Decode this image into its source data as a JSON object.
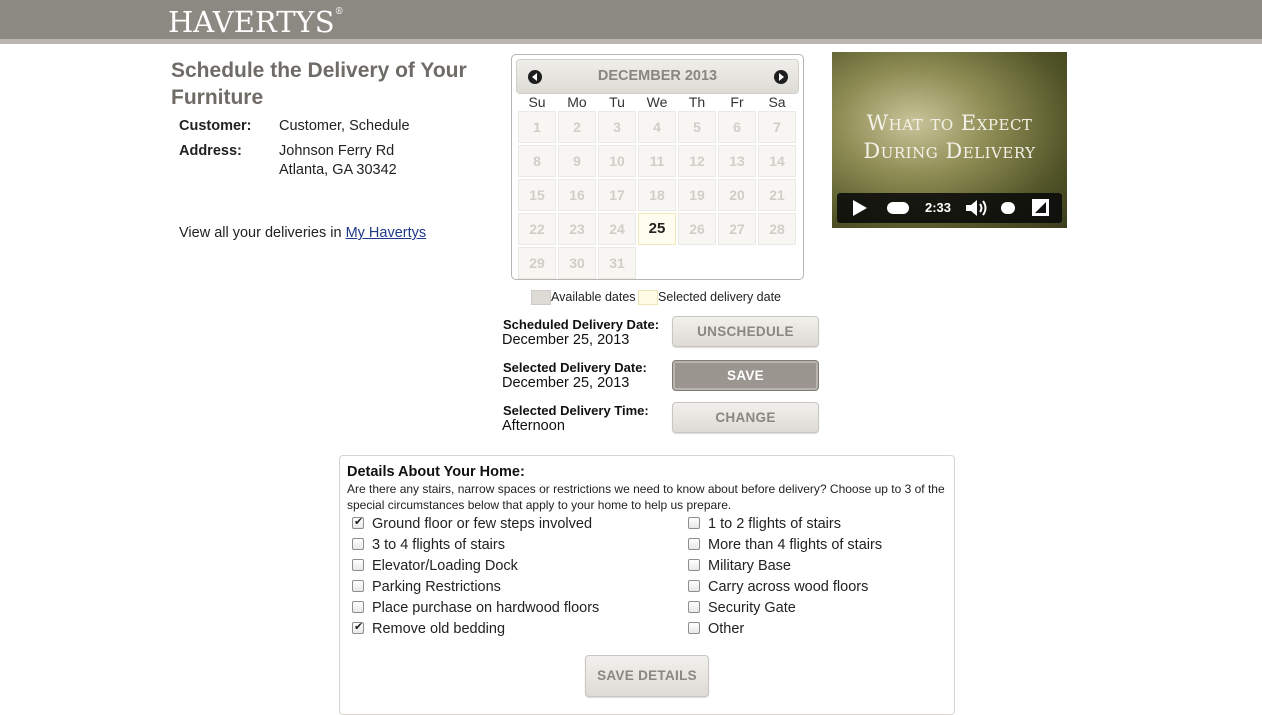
{
  "header": {
    "logo": "HAVERTYS",
    "colors": {
      "bar": "#8c8882"
    }
  },
  "main": {
    "title": "Schedule the Delivery of Your Furniture",
    "customer_label": "Customer:",
    "customer_value": "Customer, Schedule",
    "address_label": "Address:",
    "address_line1": "Johnson Ferry Rd",
    "address_line2": "Atlanta, GA 30342",
    "view_all_text": "View all your deliveries in",
    "view_all_link": "My Havertys"
  },
  "calendar": {
    "month": "DECEMBER 2013",
    "prev_icon": "chevron-left-icon",
    "next_icon": "chevron-right-icon",
    "weekdays": [
      "Su",
      "Mo",
      "Tu",
      "We",
      "Th",
      "Fr",
      "Sa"
    ],
    "days": [
      "1",
      "2",
      "3",
      "4",
      "5",
      "6",
      "7",
      "8",
      "9",
      "10",
      "11",
      "12",
      "13",
      "14",
      "15",
      "16",
      "17",
      "18",
      "19",
      "20",
      "21",
      "22",
      "23",
      "24",
      "25",
      "26",
      "27",
      "28",
      "29",
      "30",
      "31"
    ],
    "selected_day": "25"
  },
  "legend": {
    "available": "Available dates",
    "selected": "Selected delivery date"
  },
  "delivery": {
    "scheduled_label": "Scheduled Delivery Date:",
    "scheduled_value": "December 25, 2013",
    "selected_label": "Selected Delivery Date:",
    "selected_value": "December 25, 2013",
    "time_label": "Selected Delivery Time:",
    "time_value": "Afternoon",
    "unschedule_button": "UNSCHEDULE",
    "save_button": "SAVE",
    "change_button": "CHANGE"
  },
  "video": {
    "title_line1": "What to Expect",
    "title_line2": "During Delivery",
    "time": "2:33",
    "icons": [
      "play-icon",
      "volume-icon",
      "fullscreen-icon"
    ]
  },
  "details": {
    "title": "Details About Your Home:",
    "description": "Are there any stairs, narrow spaces or restrictions we need to know about before delivery? Choose up to 3 of the special circumstances below that apply to your home to help us prepare.",
    "options_left": [
      {
        "label": "Ground floor or few steps involved",
        "checked": true
      },
      {
        "label": "3 to 4 flights of stairs",
        "checked": false
      },
      {
        "label": "Elevator/Loading Dock",
        "checked": false
      },
      {
        "label": "Parking Restrictions",
        "checked": false
      },
      {
        "label": "Place purchase on hardwood floors",
        "checked": false
      },
      {
        "label": "Remove old bedding",
        "checked": true
      }
    ],
    "options_right": [
      {
        "label": "1 to 2 flights of stairs",
        "checked": false
      },
      {
        "label": "More than 4 flights of stairs",
        "checked": false
      },
      {
        "label": "Military Base",
        "checked": false
      },
      {
        "label": "Carry across wood floors",
        "checked": false
      },
      {
        "label": "Security Gate",
        "checked": false
      },
      {
        "label": "Other",
        "checked": false
      }
    ],
    "save_button": "SAVE DETAILS"
  }
}
